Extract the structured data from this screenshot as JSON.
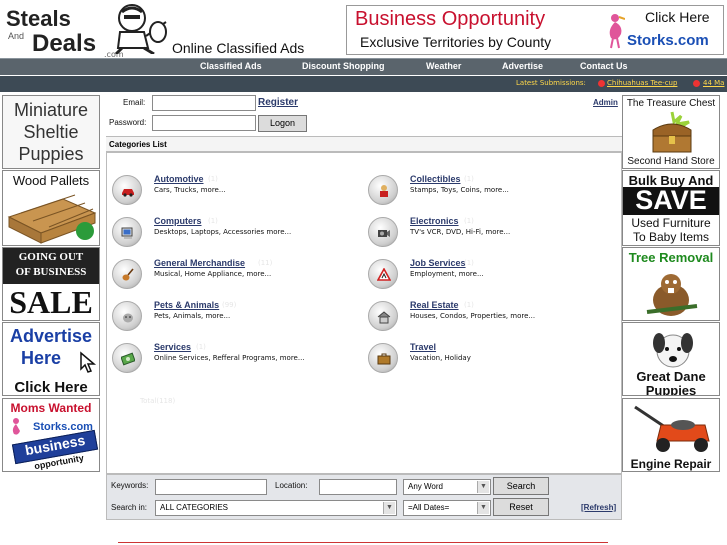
{
  "header": {
    "logo_line1": "Steals",
    "logo_line2": "And",
    "logo_line3": "Deals",
    "logo_domain": ".com",
    "tagline": "Online Classified Ads"
  },
  "top_ad": {
    "title": "Business Opportunity",
    "subtitle": "Exclusive Territories by County",
    "cta": "Click Here",
    "brand": "Storks.com"
  },
  "nav": {
    "items": [
      "Classified Ads",
      "Discount Shopping",
      "Weather",
      "Advertise",
      "Contact Us"
    ]
  },
  "latest": {
    "label": "Latest Submissions:",
    "links": [
      "Chihuahuas Tee-cup",
      "44 Ma"
    ]
  },
  "left_ads": [
    {
      "lines": [
        "Miniature",
        "Sheltie",
        "Puppies"
      ]
    },
    {
      "lines": [
        "Wood Pallets"
      ]
    },
    {
      "lines": [
        "GOING OUT",
        "OF BUSINESS",
        "SALE"
      ]
    },
    {
      "lines": [
        "Advertise",
        "Here",
        "Click Here"
      ]
    },
    {
      "lines": [
        "Moms Wanted",
        "Storks.com",
        "business",
        "opportunity"
      ]
    }
  ],
  "right_ads": [
    {
      "lines": [
        "The Treasure Chest",
        "Second Hand Store"
      ]
    },
    {
      "lines": [
        "Bulk Buy And",
        "SAVE",
        "Used Furniture",
        "To Baby Items"
      ]
    },
    {
      "lines": [
        "Tree Removal"
      ]
    },
    {
      "lines": [
        "Great Dane",
        "Puppies"
      ]
    },
    {
      "lines": [
        "Engine Repair"
      ]
    }
  ],
  "login": {
    "email_label": "Email:",
    "password_label": "Password:",
    "register": "Register",
    "logon": "Logon",
    "admin": "Admin"
  },
  "categories": {
    "title": "Categories List",
    "items": [
      {
        "name": "Automotive",
        "count": "(1)",
        "sub": "Cars, Trucks, more...",
        "icon": "car-icon"
      },
      {
        "name": "Collectibles",
        "count": "(1)",
        "sub": "Stamps, Toys, Coins, more...",
        "icon": "collectibles-icon"
      },
      {
        "name": "Computers",
        "count": "(1)",
        "sub": "Desktops, Laptops, Accessories more...",
        "icon": "computer-icon"
      },
      {
        "name": "Electronics",
        "count": "(1)",
        "sub": "TV's VCR, DVD, Hi-Fi, more...",
        "icon": "camera-icon"
      },
      {
        "name": "General Merchandise",
        "count": "(11)",
        "sub": "Musical, Home Appliance, more...",
        "icon": "guitar-icon"
      },
      {
        "name": "Job Services",
        "count": "(1)",
        "sub": "Employment, more...",
        "icon": "construction-sign-icon"
      },
      {
        "name": "Pets & Animals",
        "count": "(99)",
        "sub": "Pets, Animals, more...",
        "icon": "pet-icon"
      },
      {
        "name": "Real Estate",
        "count": "(1)",
        "sub": "Houses, Condos, Properties, more...",
        "icon": "house-icon"
      },
      {
        "name": "Services",
        "count": "(1)",
        "sub": "Online Services, Refferal Programs, more...",
        "icon": "money-icon"
      },
      {
        "name": "Travel",
        "count": "",
        "sub": "Vacation, Holiday",
        "icon": "suitcase-icon"
      }
    ],
    "total": "Total(118)"
  },
  "search": {
    "keywords_label": "Keywords:",
    "location_label": "Location:",
    "search_in_label": "Search in:",
    "match_value": "Any Word",
    "category_value": "ALL CATEGORIES",
    "date_value": "=All Dates=",
    "search_button": "Search",
    "reset_button": "Reset",
    "refresh": "[Refresh]"
  },
  "colors": {
    "nav": "#5a646c",
    "latest_bar": "#3d4a55",
    "link": "#2b3a6b",
    "brand_red": "#c8102e",
    "brand_blue": "#1a4fb5"
  }
}
